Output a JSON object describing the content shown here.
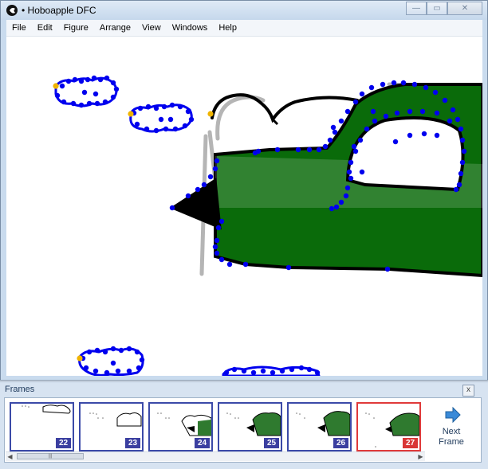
{
  "app": {
    "title": "• Hoboapple DFC"
  },
  "window_buttons": {
    "minimize": "—",
    "maximize": "▭",
    "close": "✕"
  },
  "menu": [
    "File",
    "Edit",
    "Figure",
    "Arrange",
    "View",
    "Windows",
    "Help"
  ],
  "frames_panel": {
    "title": "Frames",
    "close": "x",
    "frames": [
      {
        "number": "22",
        "selected": false
      },
      {
        "number": "23",
        "selected": false
      },
      {
        "number": "24",
        "selected": false
      },
      {
        "number": "25",
        "selected": false
      },
      {
        "number": "26",
        "selected": false
      },
      {
        "number": "27",
        "selected": true
      }
    ],
    "next_frame_label": "Next\nFrame",
    "scroll_grip": "|||"
  },
  "colors": {
    "plane_body": "#0a6b0a",
    "outline": "#000000",
    "control_point": "#0000ee",
    "start_point": "#f0b400",
    "selected_frame": "#e03a3a",
    "frame_border": "#3b4aa8"
  },
  "icons": {
    "app": "hoboapple-icon",
    "next": "arrow-right-icon",
    "close": "close-icon"
  }
}
